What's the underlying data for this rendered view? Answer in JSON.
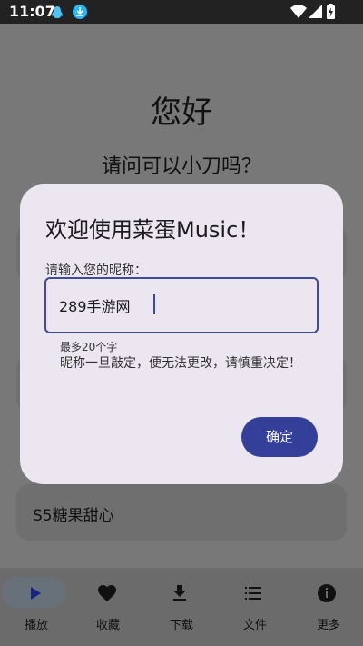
{
  "status_bar": {
    "time": "11:07",
    "icons": [
      "qq-notification-icon",
      "download-icon",
      "wifi-icon",
      "signal-icon",
      "battery-icon"
    ]
  },
  "background": {
    "greeting_title": "您好",
    "greeting_sub": "请问可以小刀吗？",
    "card_label": "S5糖果甜心"
  },
  "dialog": {
    "title": "欢迎使用菜蛋Music！",
    "field_label": "请输入您的昵称：",
    "field_value": "289手游网",
    "hint_limit": "最多20个字",
    "hint_warning": "昵称一旦敲定，便无法更改，请慎重决定！",
    "confirm_label": "确定"
  },
  "bottom_nav": {
    "items": [
      {
        "label": "播放",
        "icon": "play-icon",
        "selected": true
      },
      {
        "label": "收藏",
        "icon": "heart-icon",
        "selected": false
      },
      {
        "label": "下载",
        "icon": "download-icon",
        "selected": false
      },
      {
        "label": "文件",
        "icon": "list-icon",
        "selected": false
      },
      {
        "label": "更多",
        "icon": "info-icon",
        "selected": false
      }
    ]
  },
  "colors": {
    "accent": "#333f99",
    "dialog_bg": "#ece6f0",
    "scrim": "#787878"
  }
}
